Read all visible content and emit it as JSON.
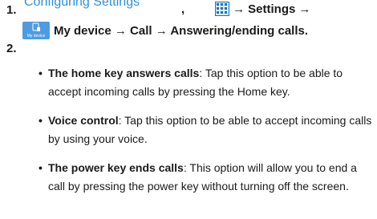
{
  "header": {
    "link_text": "Configuring Settings"
  },
  "steps": [
    {
      "number": "1.",
      "comma": ",",
      "arrow": "→",
      "settings_label": "Settings",
      "my_device_icon_caption": "My device",
      "path_text": "My device → Call → Answering/ending calls."
    },
    {
      "number": "2."
    }
  ],
  "options": [
    {
      "term": "The home key answers calls",
      "description": ": Tap this option to be able to accept incoming calls by pressing the Home key."
    },
    {
      "term": "Voice control",
      "description": ": Tap this option to be able to accept incoming calls by using your voice."
    },
    {
      "term": "The power key ends calls",
      "description": ": This option will allow you to end a call by pressing the power key without turning off the screen."
    }
  ],
  "colors": {
    "link": "#2f8fd8",
    "icon_blue": "#4f9be0",
    "grid_border": "#1f6fb8"
  },
  "icons": [
    "apps-grid-icon",
    "my-device-icon"
  ]
}
